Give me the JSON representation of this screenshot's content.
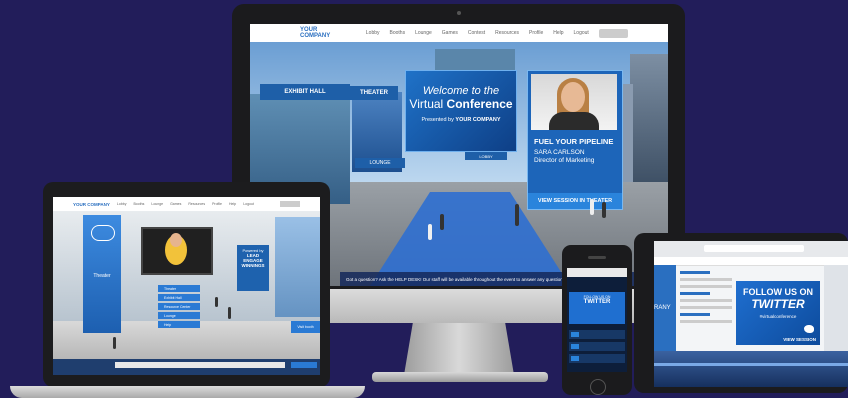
{
  "desktop": {
    "nav": {
      "logo": "YOUR COMPANY",
      "items": [
        "Lobby",
        "Booths",
        "Lounge",
        "Games",
        "Contest",
        "Resources",
        "Profile",
        "Help",
        "Logout"
      ]
    },
    "signs": {
      "exhibit_hall": "EXHIBIT HALL",
      "theater": "THEATER",
      "lounge": "LOUNGE",
      "lobby": "LOBBY"
    },
    "welcome": {
      "line1": "Welcome to the",
      "line2_a": "Virtual",
      "line2_b": "Conference",
      "presented_by": "Presented by",
      "company": "YOUR COMPANY"
    },
    "speaker": {
      "headline": "FUEL YOUR PIPELINE",
      "name": "SARA CARLSON",
      "role": "Director of Marketing",
      "cta": "VIEW SESSION IN THEATER"
    },
    "ticker": "Got a question? Ask the HELP DESK! Our staff will be available throughout the event to answer any questions"
  },
  "laptop": {
    "nav": {
      "logo": "YOUR COMPANY",
      "items": [
        "Lobby",
        "Booths",
        "Lounge",
        "Games",
        "Resources",
        "Profile",
        "Help",
        "Logout"
      ]
    },
    "theater_label": "Theater",
    "menu": [
      "Theater",
      "Exhibit Hall",
      "Resource Center",
      "Lounge",
      "Help"
    ],
    "panel": {
      "small": "Powered by",
      "bold": "LEAD ENGAGE WINNINGS"
    },
    "booth": "Visit booth"
  },
  "phone": {
    "twitter_small": "FOLLOW US ON",
    "twitter_big": "TWITTER"
  },
  "tablet": {
    "side_text": "RANY",
    "twitter_a": "FOLLOW US ON",
    "twitter_b": "TWITTER",
    "handle": "#virtualconference",
    "cta": "VIEW SESSION"
  }
}
